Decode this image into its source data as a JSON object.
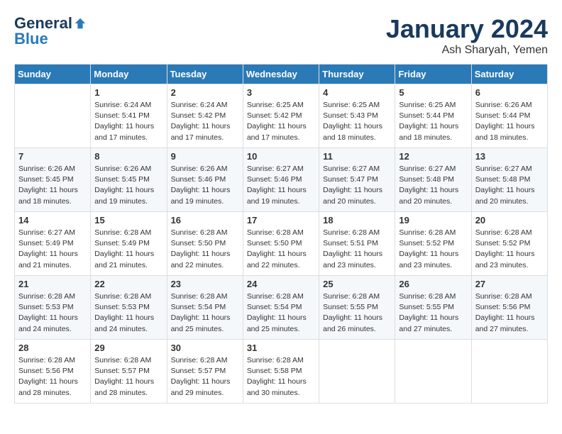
{
  "header": {
    "logo_general": "General",
    "logo_blue": "Blue",
    "month": "January 2024",
    "location": "Ash Sharyah, Yemen"
  },
  "weekdays": [
    "Sunday",
    "Monday",
    "Tuesday",
    "Wednesday",
    "Thursday",
    "Friday",
    "Saturday"
  ],
  "weeks": [
    [
      {
        "day": "",
        "sunrise": "",
        "sunset": "",
        "daylight": ""
      },
      {
        "day": "1",
        "sunrise": "6:24 AM",
        "sunset": "5:41 PM",
        "daylight": "11 hours and 17 minutes."
      },
      {
        "day": "2",
        "sunrise": "6:24 AM",
        "sunset": "5:42 PM",
        "daylight": "11 hours and 17 minutes."
      },
      {
        "day": "3",
        "sunrise": "6:25 AM",
        "sunset": "5:42 PM",
        "daylight": "11 hours and 17 minutes."
      },
      {
        "day": "4",
        "sunrise": "6:25 AM",
        "sunset": "5:43 PM",
        "daylight": "11 hours and 18 minutes."
      },
      {
        "day": "5",
        "sunrise": "6:25 AM",
        "sunset": "5:44 PM",
        "daylight": "11 hours and 18 minutes."
      },
      {
        "day": "6",
        "sunrise": "6:26 AM",
        "sunset": "5:44 PM",
        "daylight": "11 hours and 18 minutes."
      }
    ],
    [
      {
        "day": "7",
        "sunrise": "6:26 AM",
        "sunset": "5:45 PM",
        "daylight": "11 hours and 18 minutes."
      },
      {
        "day": "8",
        "sunrise": "6:26 AM",
        "sunset": "5:45 PM",
        "daylight": "11 hours and 19 minutes."
      },
      {
        "day": "9",
        "sunrise": "6:26 AM",
        "sunset": "5:46 PM",
        "daylight": "11 hours and 19 minutes."
      },
      {
        "day": "10",
        "sunrise": "6:27 AM",
        "sunset": "5:46 PM",
        "daylight": "11 hours and 19 minutes."
      },
      {
        "day": "11",
        "sunrise": "6:27 AM",
        "sunset": "5:47 PM",
        "daylight": "11 hours and 20 minutes."
      },
      {
        "day": "12",
        "sunrise": "6:27 AM",
        "sunset": "5:48 PM",
        "daylight": "11 hours and 20 minutes."
      },
      {
        "day": "13",
        "sunrise": "6:27 AM",
        "sunset": "5:48 PM",
        "daylight": "11 hours and 20 minutes."
      }
    ],
    [
      {
        "day": "14",
        "sunrise": "6:27 AM",
        "sunset": "5:49 PM",
        "daylight": "11 hours and 21 minutes."
      },
      {
        "day": "15",
        "sunrise": "6:28 AM",
        "sunset": "5:49 PM",
        "daylight": "11 hours and 21 minutes."
      },
      {
        "day": "16",
        "sunrise": "6:28 AM",
        "sunset": "5:50 PM",
        "daylight": "11 hours and 22 minutes."
      },
      {
        "day": "17",
        "sunrise": "6:28 AM",
        "sunset": "5:50 PM",
        "daylight": "11 hours and 22 minutes."
      },
      {
        "day": "18",
        "sunrise": "6:28 AM",
        "sunset": "5:51 PM",
        "daylight": "11 hours and 23 minutes."
      },
      {
        "day": "19",
        "sunrise": "6:28 AM",
        "sunset": "5:52 PM",
        "daylight": "11 hours and 23 minutes."
      },
      {
        "day": "20",
        "sunrise": "6:28 AM",
        "sunset": "5:52 PM",
        "daylight": "11 hours and 23 minutes."
      }
    ],
    [
      {
        "day": "21",
        "sunrise": "6:28 AM",
        "sunset": "5:53 PM",
        "daylight": "11 hours and 24 minutes."
      },
      {
        "day": "22",
        "sunrise": "6:28 AM",
        "sunset": "5:53 PM",
        "daylight": "11 hours and 24 minutes."
      },
      {
        "day": "23",
        "sunrise": "6:28 AM",
        "sunset": "5:54 PM",
        "daylight": "11 hours and 25 minutes."
      },
      {
        "day": "24",
        "sunrise": "6:28 AM",
        "sunset": "5:54 PM",
        "daylight": "11 hours and 25 minutes."
      },
      {
        "day": "25",
        "sunrise": "6:28 AM",
        "sunset": "5:55 PM",
        "daylight": "11 hours and 26 minutes."
      },
      {
        "day": "26",
        "sunrise": "6:28 AM",
        "sunset": "5:55 PM",
        "daylight": "11 hours and 27 minutes."
      },
      {
        "day": "27",
        "sunrise": "6:28 AM",
        "sunset": "5:56 PM",
        "daylight": "11 hours and 27 minutes."
      }
    ],
    [
      {
        "day": "28",
        "sunrise": "6:28 AM",
        "sunset": "5:56 PM",
        "daylight": "11 hours and 28 minutes."
      },
      {
        "day": "29",
        "sunrise": "6:28 AM",
        "sunset": "5:57 PM",
        "daylight": "11 hours and 28 minutes."
      },
      {
        "day": "30",
        "sunrise": "6:28 AM",
        "sunset": "5:57 PM",
        "daylight": "11 hours and 29 minutes."
      },
      {
        "day": "31",
        "sunrise": "6:28 AM",
        "sunset": "5:58 PM",
        "daylight": "11 hours and 30 minutes."
      },
      {
        "day": "",
        "sunrise": "",
        "sunset": "",
        "daylight": ""
      },
      {
        "day": "",
        "sunrise": "",
        "sunset": "",
        "daylight": ""
      },
      {
        "day": "",
        "sunrise": "",
        "sunset": "",
        "daylight": ""
      }
    ]
  ],
  "labels": {
    "sunrise": "Sunrise:",
    "sunset": "Sunset:",
    "daylight": "Daylight:"
  }
}
